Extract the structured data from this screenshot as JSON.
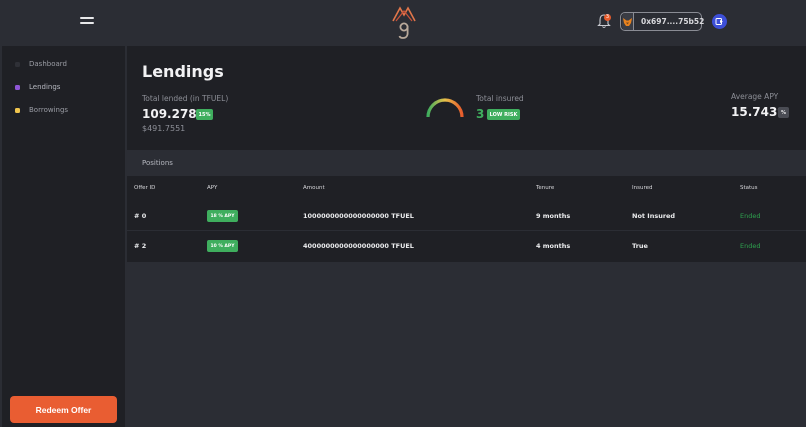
{
  "header": {
    "notification_count": "3",
    "wallet_address": "0x697....75b52"
  },
  "sidebar": {
    "items": [
      {
        "label": "Dashboard",
        "color": "#2f3037"
      },
      {
        "label": "Lendings",
        "color": "#8e55d6"
      },
      {
        "label": "Borrowings",
        "color": "#f0c54e"
      }
    ],
    "redeem_label": "Redeem Offer"
  },
  "main": {
    "title": "Lendings",
    "total_lended": {
      "label": "Total lended (in TFUEL)",
      "value": "109.2789",
      "badge": "15%",
      "usd": "$491.7551"
    },
    "total_insured": {
      "label": "Total insured",
      "value": "3",
      "badge": "LOW RISK"
    },
    "average_apy": {
      "label": "Average APY",
      "value": "15.7439",
      "badge": "%"
    }
  },
  "positions": {
    "title": "Positions",
    "columns": [
      "Offer ID",
      "APY",
      "Amount",
      "Tenure",
      "Insured",
      "Status"
    ],
    "rows": [
      {
        "id": "# 0",
        "apy": "18 % APY",
        "amount": "1000000000000000000 TFUEL",
        "tenure": "9 months",
        "insured": "Not Insured",
        "status": "Ended"
      },
      {
        "id": "# 2",
        "apy": "10 % APY",
        "amount": "4000000000000000000 TFUEL",
        "tenure": "4 months",
        "insured": "True",
        "status": "Ended"
      }
    ]
  },
  "colors": {
    "accent": "#e95d32",
    "success": "#3fae5e",
    "panel": "#1f2025",
    "background": "#2b2d34"
  }
}
